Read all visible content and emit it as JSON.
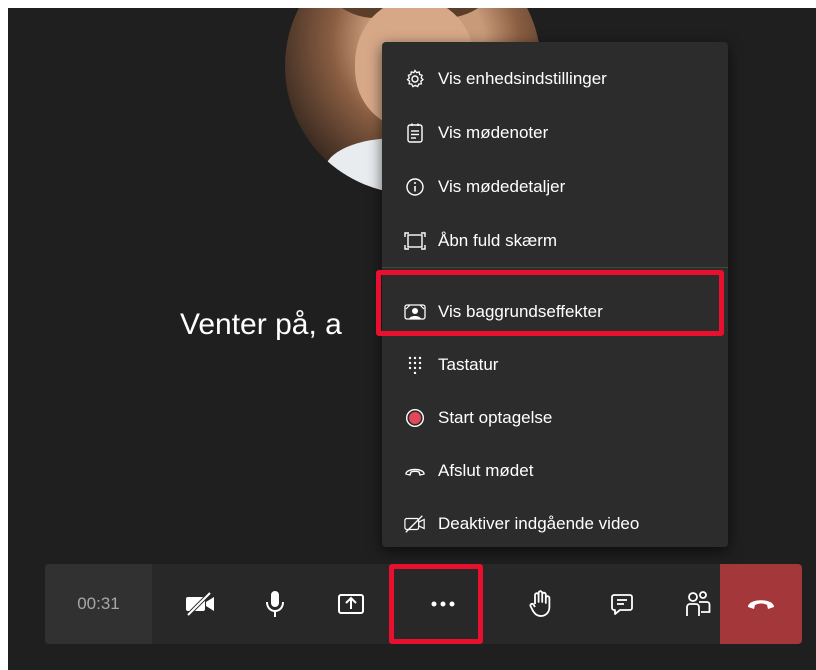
{
  "waiting_text": "Venter på, a",
  "menu": {
    "items": [
      {
        "label": "Vis enhedsindstillinger",
        "icon": "gear-icon"
      },
      {
        "label": "Vis mødenoter",
        "icon": "notes-icon"
      },
      {
        "label": "Vis mødedetaljer",
        "icon": "info-icon"
      },
      {
        "label": "Åbn fuld skærm",
        "icon": "fullscreen-icon"
      },
      {
        "label": "Vis baggrundseffekter",
        "icon": "background-effects-icon"
      },
      {
        "label": "Tastatur",
        "icon": "keypad-icon"
      },
      {
        "label": "Start optagelse",
        "icon": "record-icon"
      },
      {
        "label": "Afslut mødet",
        "icon": "end-meeting-icon"
      },
      {
        "label": "Deaktiver indgående video",
        "icon": "incoming-video-off-icon"
      }
    ]
  },
  "toolbar": {
    "timer": "00:31",
    "buttons": [
      "camera-off-icon",
      "microphone-icon",
      "share-screen-icon",
      "more-options-icon",
      "raise-hand-icon",
      "chat-icon",
      "participants-icon",
      "hang-up-icon"
    ]
  },
  "colors": {
    "background": "#1f1f1f",
    "menu": "#2d2c2c",
    "highlight": "#e8102e",
    "hangup": "#a4373a",
    "record": "#e3475a"
  }
}
